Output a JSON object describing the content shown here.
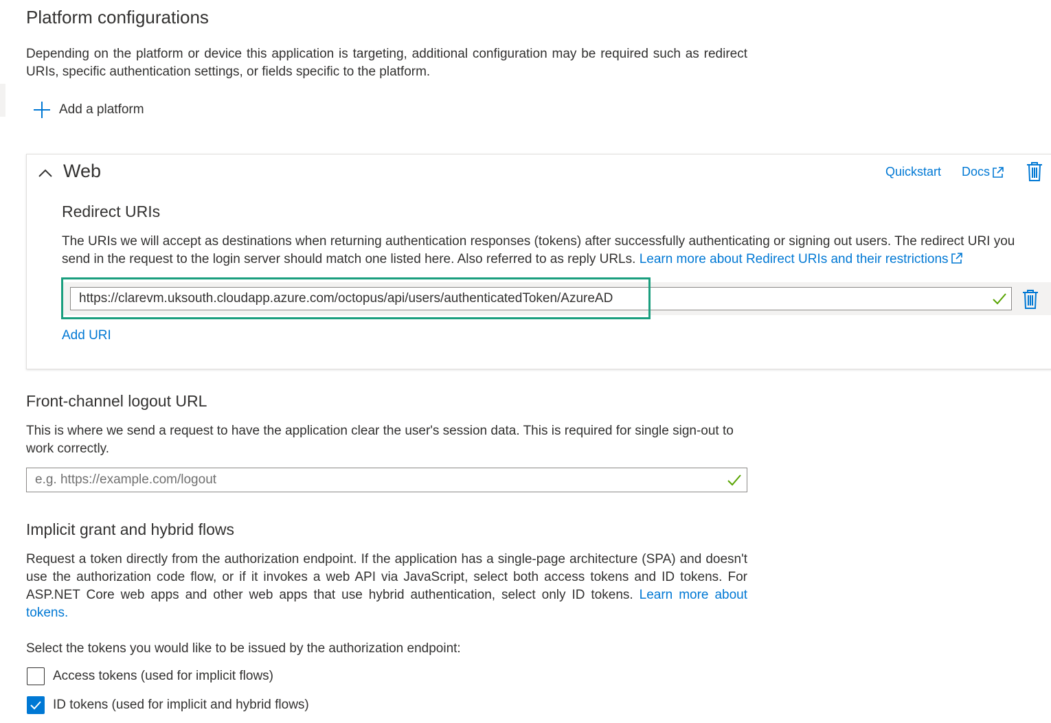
{
  "platform": {
    "title": "Platform configurations",
    "description": "Depending on the platform or device this application is targeting, additional configuration may be required such as redirect URIs, specific authentication settings, or fields specific to the platform.",
    "add_platform_label": "Add a platform"
  },
  "web": {
    "title": "Web",
    "quickstart_label": "Quickstart",
    "docs_label": "Docs",
    "redirect": {
      "heading": "Redirect URIs",
      "description": "The URIs we will accept as destinations when returning authentication responses (tokens) after successfully authenticating or signing out users. The redirect URI you send in the request to the login server should match one listed here. Also referred to as reply URLs.",
      "learn_more": "Learn more about Redirect URIs and their restrictions",
      "uri_value": "https://clarevm.uksouth.cloudapp.azure.com/octopus/api/users/authenticatedToken/AzureAD",
      "add_uri_label": "Add URI"
    }
  },
  "logout": {
    "heading": "Front-channel logout URL",
    "description": "This is where we send a request to have the application clear the user's session data. This is required for single sign-out to work correctly.",
    "placeholder": "e.g. https://example.com/logout"
  },
  "implicit": {
    "heading": "Implicit grant and hybrid flows",
    "description": "Request a token directly from the authorization endpoint. If the application has a single-page architecture (SPA) and doesn't use the authorization code flow, or if it invokes a web API via JavaScript, select both access tokens and ID tokens. For ASP.NET Core web apps and other web apps that use hybrid authentication, select only ID tokens.",
    "learn_more": "Learn more about tokens.",
    "select_prompt": "Select the tokens you would like to be issued by the authorization endpoint:",
    "options": [
      {
        "label": "Access tokens (used for implicit flows)",
        "checked": false
      },
      {
        "label": "ID tokens (used for implicit and hybrid flows)",
        "checked": true
      }
    ]
  },
  "colors": {
    "accent": "#0078d4",
    "valid_check": "#57a300",
    "highlight_border": "#1a9e7e"
  }
}
